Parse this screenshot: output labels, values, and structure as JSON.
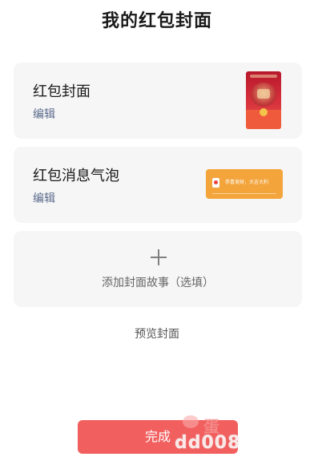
{
  "page": {
    "title": "我的红包封面"
  },
  "cards": {
    "cover": {
      "label": "红包封面",
      "edit": "编辑"
    },
    "bubble": {
      "label": "红包消息气泡",
      "edit": "编辑",
      "preview_text": "恭喜发财，大吉大利"
    },
    "story": {
      "label": "添加封面故事（选填）",
      "icon": "plus-icon"
    }
  },
  "preview_link": "预览封面",
  "done_button": "完成",
  "watermark": {
    "brand": "蛋",
    "text": "dd008"
  },
  "colors": {
    "accent_button": "#f25f5f",
    "edit_link": "#5b6b8c",
    "cover_red": "#d8323c",
    "bubble_orange": "#f3a43b",
    "card_bg": "#f6f6f6"
  }
}
